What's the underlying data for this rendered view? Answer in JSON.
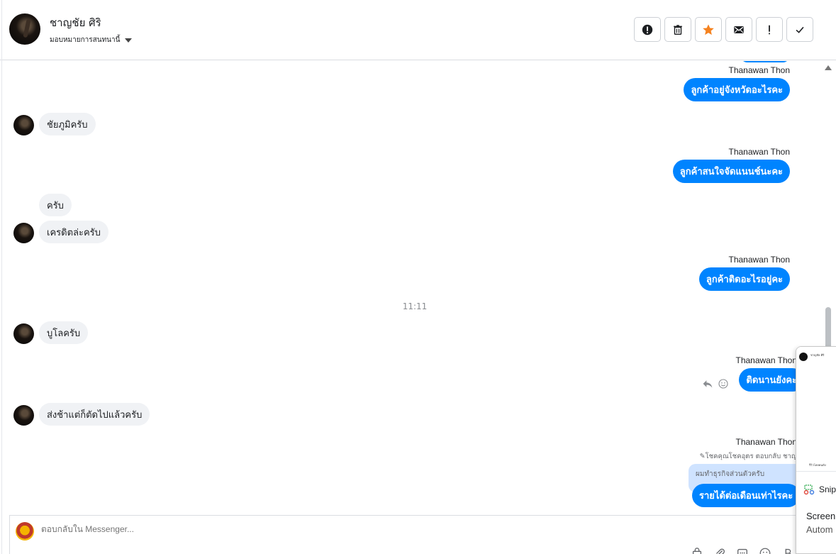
{
  "header": {
    "contact_name": "ชาญชัย ศิริ",
    "assign_label": "มอบหมายการสนทนานี้",
    "toolbar": [
      {
        "name": "spam-button",
        "icon": "alert-circle-icon"
      },
      {
        "name": "delete-button",
        "icon": "trash-icon"
      },
      {
        "name": "star-button",
        "icon": "star-icon",
        "color": "#f5821f"
      },
      {
        "name": "mark-unread-button",
        "icon": "envelope-icon"
      },
      {
        "name": "follow-up-button",
        "icon": "exclamation-icon"
      },
      {
        "name": "done-button",
        "icon": "check-icon"
      }
    ]
  },
  "messages": {
    "m1": {
      "sender": "Thanawan Thon",
      "text": "ลูกค้าอยู่จังหวัดอะไรคะ"
    },
    "m2": {
      "text": "ชัยภูมิครับ"
    },
    "m3": {
      "sender": "Thanawan Thon",
      "text": "ลูกค้าสนใจจัดแนนช์นะคะ"
    },
    "m4": {
      "text": "ครับ"
    },
    "m5": {
      "text": "เครดิตล่ะครับ"
    },
    "m6": {
      "sender": "Thanawan Thon",
      "text": "ลูกค้าติดอะไรอยู่คะ"
    },
    "time_separator": "11:11",
    "m7": {
      "text": "บูโลครับ"
    },
    "m8": {
      "sender": "Thanawan Thon",
      "text": "ติดนานยังคะ"
    },
    "m9": {
      "text": "ส่งช้าแต่ก็ตัดไปแล้วครับ"
    },
    "m10": {
      "sender": "Thanawan Thon",
      "reply_hint": "โชคคุณโชคอุตร ตอบกลับ ชาญ",
      "quote": "ผมทำธุรกิจส่วนตัวครับ",
      "text": "รายได้ต่อเดือนเท่าไรคะ"
    }
  },
  "composer": {
    "placeholder": "ตอบกลับใน Messenger..."
  },
  "snip_popup": {
    "thumb_line1": "ชาญชัย ศิริ",
    "thumb_line2": "รีวิวโดยคนดัง",
    "app_name": "Snip",
    "title": "Screen",
    "subtitle": "Autom"
  },
  "colors": {
    "outgoing_bubble": "#0084ff",
    "incoming_bubble": "#f0f2f5",
    "quote_bubble": "#cfe3ff"
  }
}
